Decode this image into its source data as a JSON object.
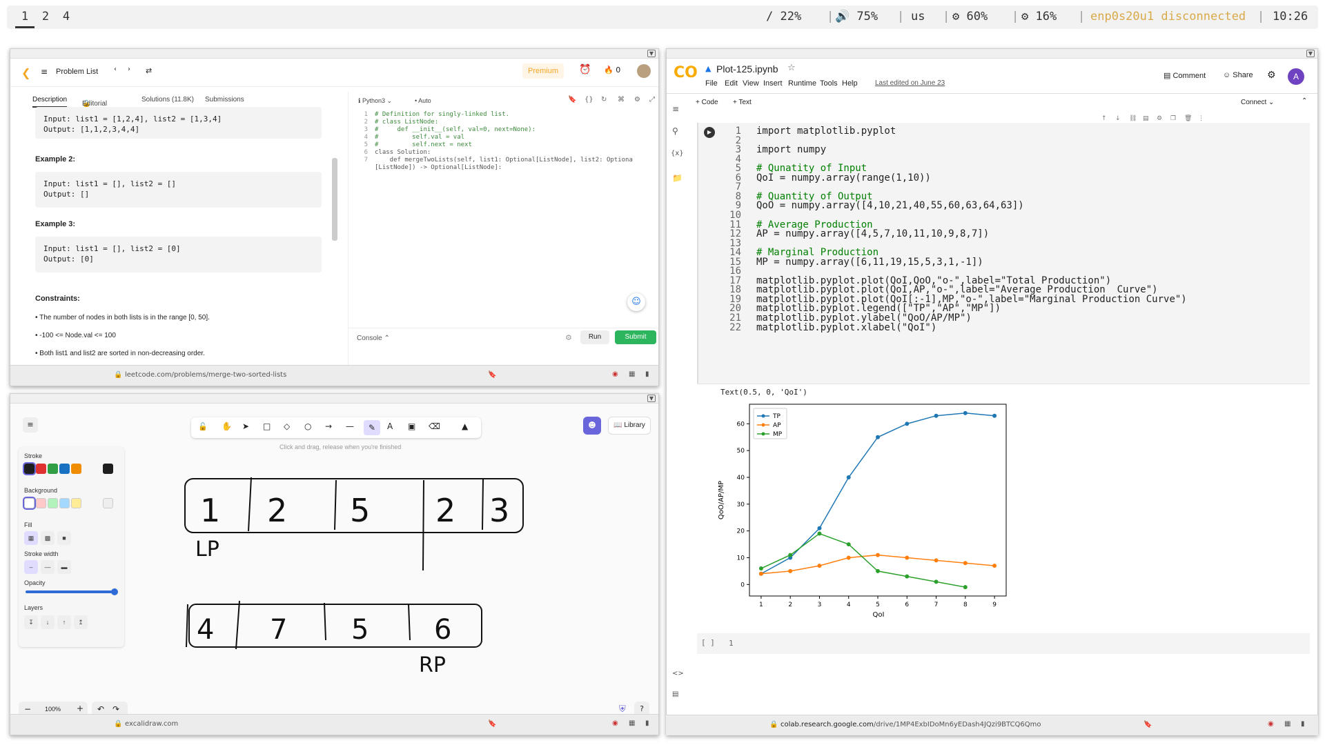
{
  "topbar": {
    "workspaces": [
      "1",
      "2",
      "4"
    ],
    "active_workspace": "1",
    "disk": "/ 22%",
    "volume": "🔊 75%",
    "keyboard": "us",
    "cpu": "60%",
    "mem": "16%",
    "network": "enp0s20u1 disconnected",
    "clock": "10:26"
  },
  "leetcode": {
    "nav_title": "Problem List",
    "premium": "Premium",
    "streak": "0",
    "tabs": [
      "Description",
      "Editorial",
      "Solutions (11.8K)",
      "Submissions"
    ],
    "example1": {
      "input": "Input: list1 = [1,2,4], list2 = [1,3,4]",
      "output": "Output: [1,1,2,3,4,4]"
    },
    "example2_title": "Example 2:",
    "example2": {
      "input": "Input: list1 = [], list2 = []",
      "output": "Output: []"
    },
    "example3_title": "Example 3:",
    "example3": {
      "input": "Input: list1 = [], list2 = [0]",
      "output": "Output: [0]"
    },
    "constraints_title": "Constraints:",
    "constraints": [
      "The number of nodes in both lists is in the range [0, 50].",
      "-100 <= Node.val <= 100",
      "Both list1 and list2 are sorted in non-decreasing order."
    ],
    "language": "Python3",
    "auto": "Auto",
    "code_lines": [
      "# Definition for singly-linked list.",
      "# class ListNode:",
      "#     def __init__(self, val=0, next=None):",
      "#         self.val = val",
      "#         self.next = next",
      "class Solution:",
      "    def mergeTwoLists(self, list1: Optional[ListNode], list2: Optiona",
      "[ListNode]) -> Optional[ListNode]:"
    ],
    "code_line_numbers": [
      "1",
      "2",
      "3",
      "4",
      "5",
      "6",
      "7",
      ""
    ],
    "console": "Console",
    "run": "Run",
    "submit": "Submit",
    "url": "leetcode.com/problems/merge-two-sorted-lists"
  },
  "excalidraw": {
    "library": "Library",
    "hint": "Click and drag, release when you're finished",
    "stroke_label": "Stroke",
    "background_label": "Background",
    "fill_label": "Fill",
    "stroke_width_label": "Stroke width",
    "opacity_label": "Opacity",
    "layers_label": "Layers",
    "opacity_value": 1.0,
    "zoom": "100%",
    "url": "excalidraw.com",
    "stroke_colors": [
      "#1e1e1e",
      "#e03131",
      "#2f9e44",
      "#1971c2",
      "#f08c00"
    ],
    "bg_colors": [
      "#ffffff",
      "#ffc9c9",
      "#b2f2bb",
      "#a5d8ff",
      "#ffec99"
    ],
    "drawing_top_row": [
      "1",
      "2",
      "5",
      "2",
      "3"
    ],
    "drawing_top_label": "LP",
    "drawing_bottom_row": [
      "4",
      "7",
      "5",
      "6"
    ],
    "drawing_bottom_label": "RP"
  },
  "colab": {
    "notebook_title": "Plot-125.ipynb",
    "menu": [
      "File",
      "Edit",
      "View",
      "Insert",
      "Runtime",
      "Tools",
      "Help"
    ],
    "last_edited": "Last edited on June 23",
    "comment": "Comment",
    "share": "Share",
    "avatar": "A",
    "add_code": "+ Code",
    "add_text": "+ Text",
    "connect": "Connect",
    "code": [
      "import matplotlib.pyplot",
      "",
      "import numpy",
      "",
      "# Qunatity of Input",
      "QoI = numpy.array(range(1,10))",
      "",
      "# Quantity of Output",
      "QoO = numpy.array([4,10,21,40,55,60,63,64,63])",
      "",
      "# Average Production",
      "AP = numpy.array([4,5,7,10,11,10,9,8,7])",
      "",
      "# Marginal Production",
      "MP = numpy.array([6,11,19,15,5,3,1,-1])",
      "",
      "matplotlib.pyplot.plot(QoI,QoO,\"o-\",label=\"Total Production\")",
      "matplotlib.pyplot.plot(QoI,AP,\"o-\",label=\"Average Production  Curve\")",
      "matplotlib.pyplot.plot(QoI[:-1],MP,\"o-\",label=\"Marginal Production Curve\")",
      "matplotlib.pyplot.legend([\"TP\",\"AP\",\"MP\"])",
      "matplotlib.pyplot.ylabel(\"QoO/AP/MP\")",
      "matplotlib.pyplot.xlabel(\"QoI\")"
    ],
    "output_text": "Text(0.5, 0, 'QoI')",
    "empty_cell_brackets": "[ ]",
    "empty_cell_line": "1",
    "url_host": "colab.research.google.com",
    "url_path": "/drive/1MP4ExbIDoMn6yEDash4JQzi9BTCQ6Qmo"
  },
  "chart_data": {
    "type": "line",
    "x": [
      1,
      2,
      3,
      4,
      5,
      6,
      7,
      8,
      9
    ],
    "series": [
      {
        "name": "TP",
        "values": [
          4,
          10,
          21,
          40,
          55,
          60,
          63,
          64,
          63
        ],
        "color": "#1f77b4"
      },
      {
        "name": "AP",
        "values": [
          4,
          5,
          7,
          10,
          11,
          10,
          9,
          8,
          7
        ],
        "color": "#ff7f0e"
      },
      {
        "name": "MP",
        "values": [
          6,
          11,
          19,
          15,
          5,
          3,
          1,
          -1
        ],
        "color": "#2ca02c"
      }
    ],
    "xlabel": "QoI",
    "ylabel": "QoO/AP/MP",
    "xticks": [
      1,
      2,
      3,
      4,
      5,
      6,
      7,
      8,
      9
    ],
    "yticks": [
      0,
      10,
      20,
      30,
      40,
      50,
      60
    ],
    "xlim": [
      0.6,
      9.4
    ],
    "ylim": [
      -4.3,
      67.3
    ],
    "legend": "upper left",
    "grid": false
  }
}
